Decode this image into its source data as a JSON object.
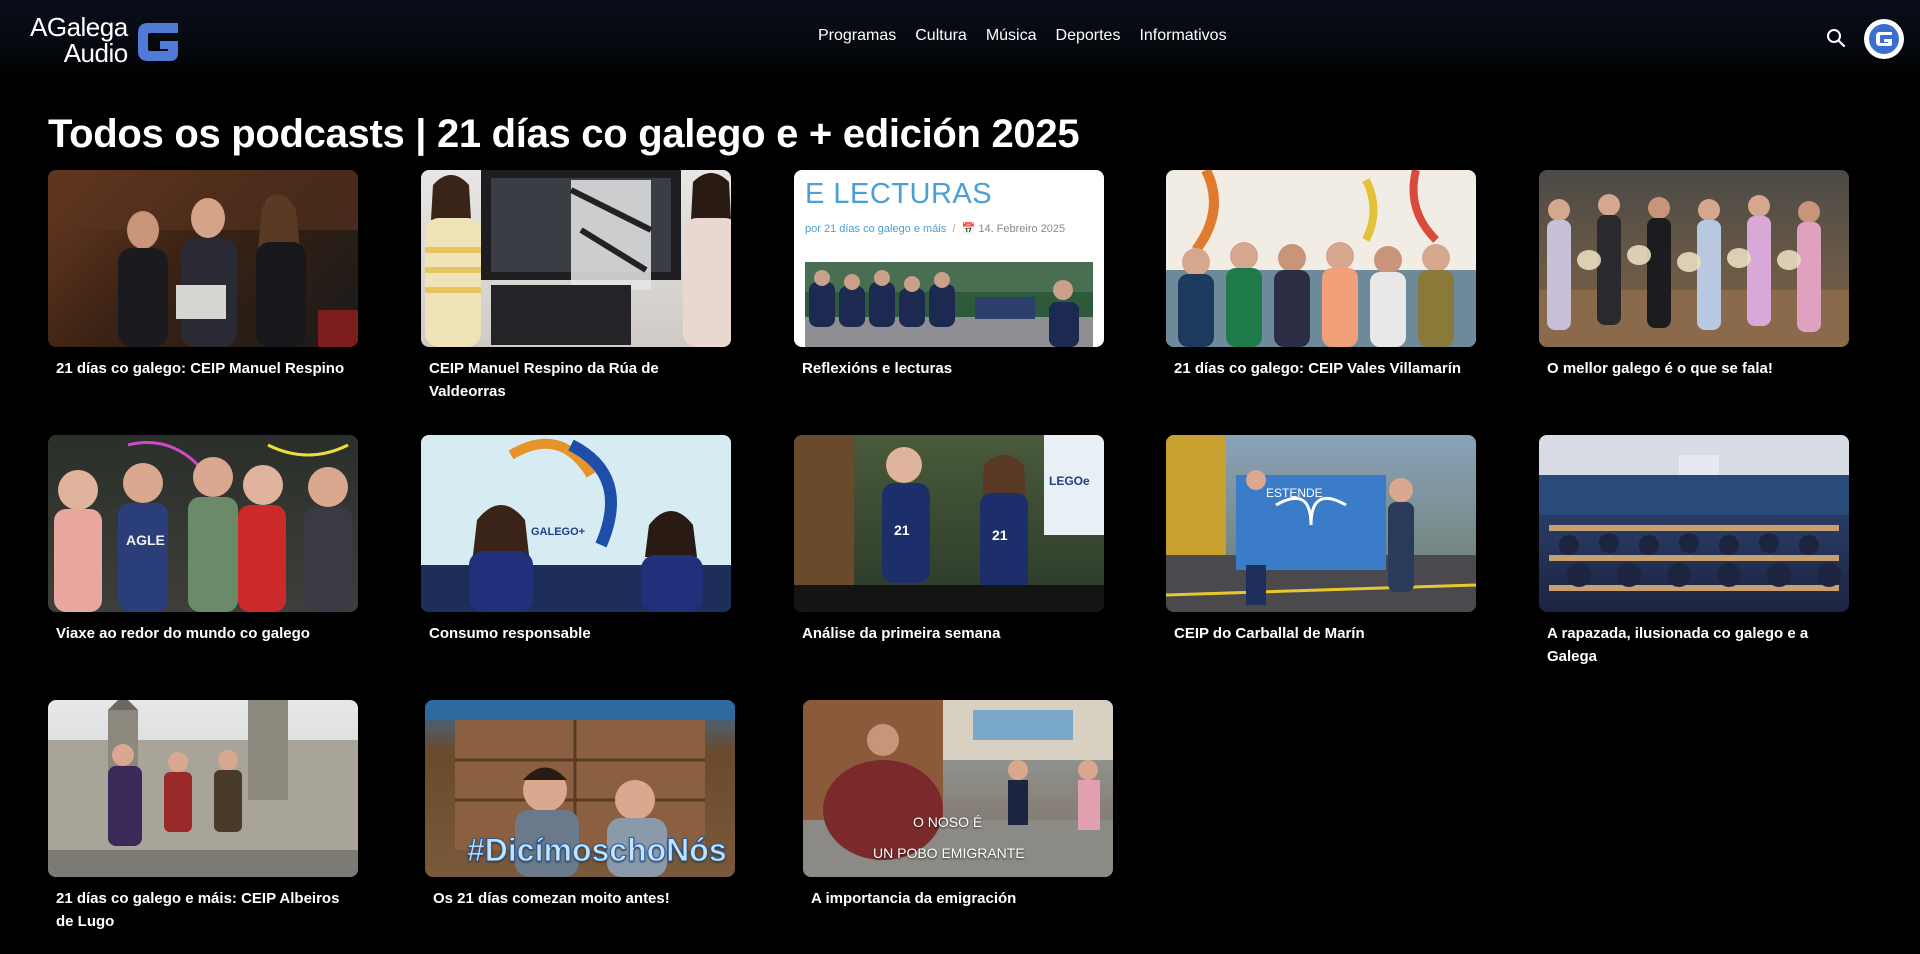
{
  "header": {
    "logo_line1": "AGalega",
    "logo_line2": "Audio",
    "nav": [
      "Programas",
      "Cultura",
      "Música",
      "Deportes",
      "Informativos"
    ],
    "accent": "#4f7ad6"
  },
  "page_title": "Todos os podcasts | 21 días co galego e + edición 2025",
  "podcasts": [
    {
      "title": "21 días co galego: CEIP Manuel Respino"
    },
    {
      "title": "CEIP Manuel Respino da Rúa de Valdeorras"
    },
    {
      "title": "Reflexións e lecturas",
      "thumb_title": "E LECTURAS",
      "thumb_author": "por 21 días co galego e máis",
      "thumb_date": "14. Febreiro 2025"
    },
    {
      "title": "21 días co galego: CEIP Vales Villamarín"
    },
    {
      "title": "O mellor galego é o que se fala!"
    },
    {
      "title": "Viaxe ao redor do mundo co galego"
    },
    {
      "title": "Consumo responsable"
    },
    {
      "title": "Análise da primeira semana"
    },
    {
      "title": "CEIP do Carballal de Marín",
      "thumb_banner": "ESTENDE"
    },
    {
      "title": "A rapazada, ilusionada co galego e a Galega"
    },
    {
      "title": "21 días co galego e máis: CEIP Albeiros de Lugo"
    },
    {
      "title": "Os 21 días comezan moito antes!",
      "thumb_hashtag": "#DicímoschoNós"
    },
    {
      "title": "A importancia da emigración",
      "thumb_line1": "O NOSO É",
      "thumb_line2": "UN POBO EMIGRANTE"
    }
  ]
}
